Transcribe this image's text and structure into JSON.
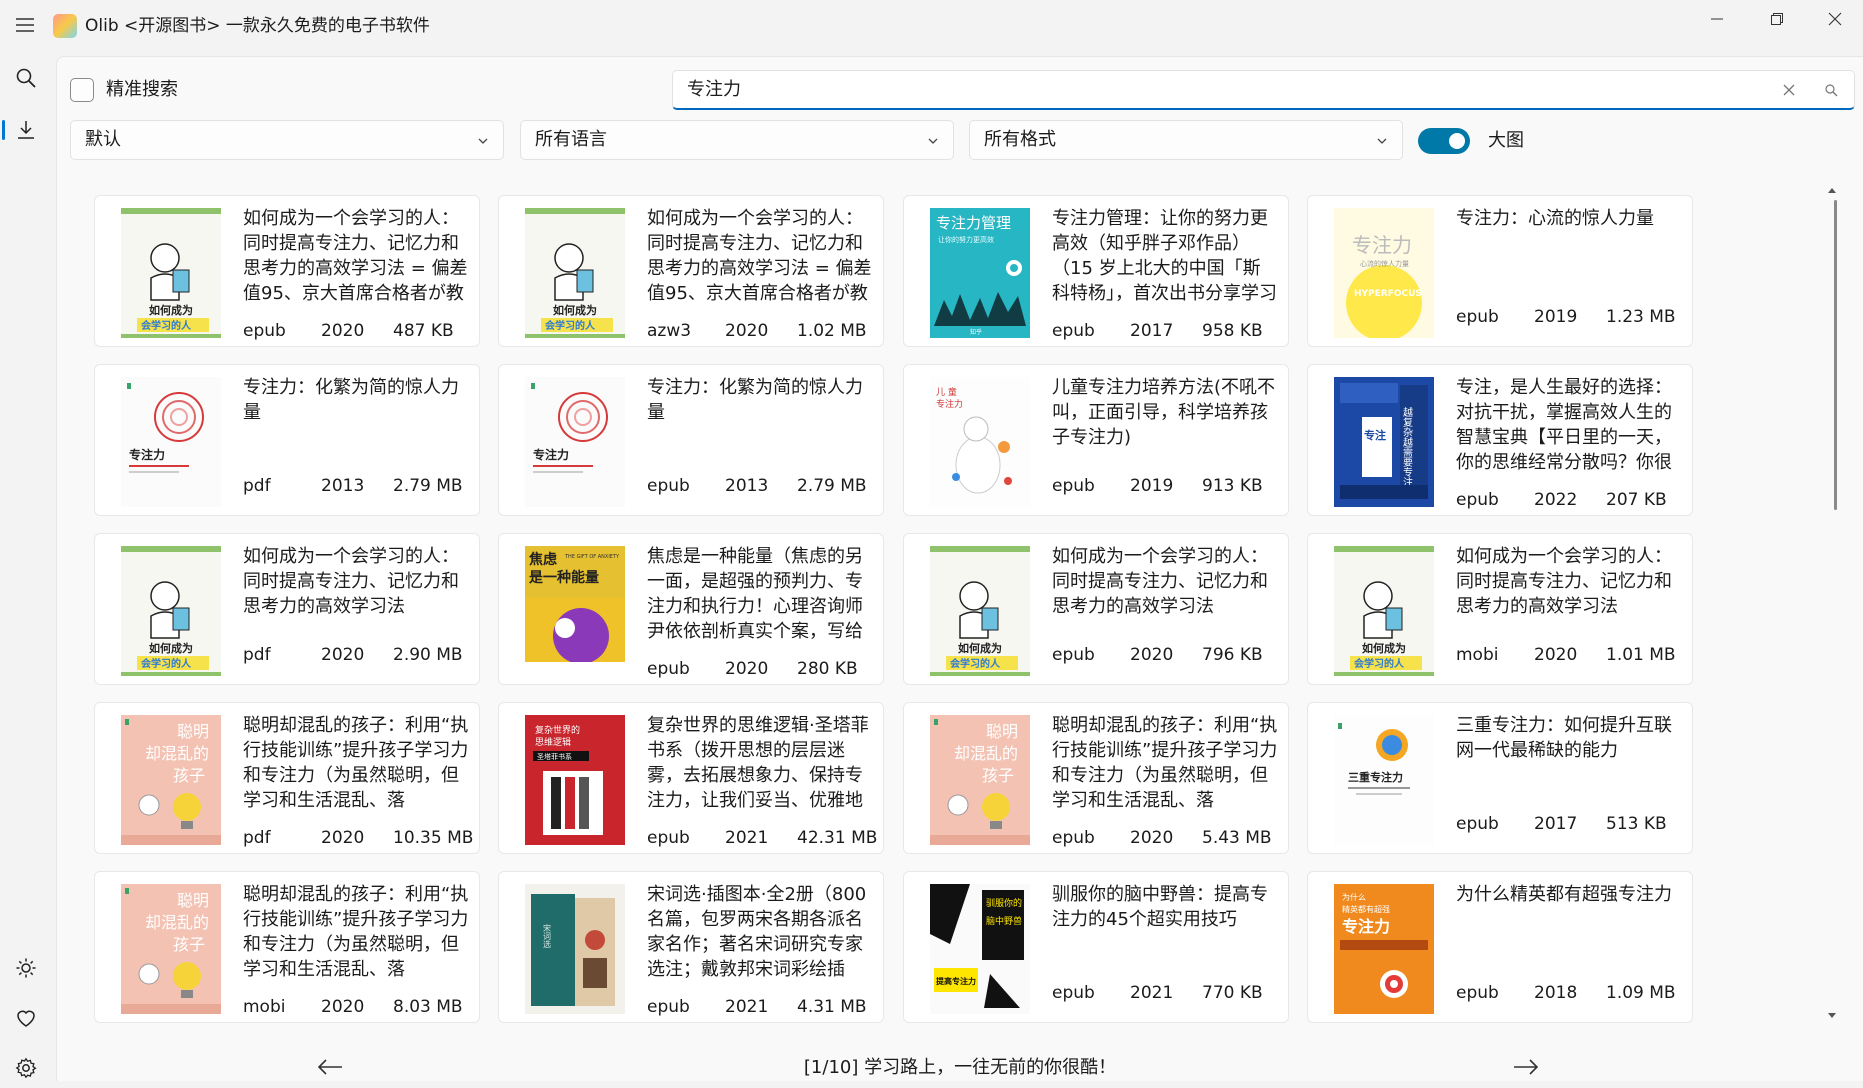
{
  "app": {
    "title": "Olib <开源图书> 一款永久免费的电子书软件"
  },
  "search": {
    "exact_label": "精准搜索",
    "exact_checked": false,
    "query": "专注力"
  },
  "filters": {
    "sort": "默认",
    "language": "所有语言",
    "format": "所有格式",
    "large_cover_label": "大图",
    "large_cover_on": true
  },
  "books": [
    {
      "title": "如何成为一个会学习的人：同时提高专注力、记忆力和思考力的高效学习法 = 偏差值95、京大首席合格者が教",
      "format": "epub",
      "year": "2020",
      "size": "487 KB"
    },
    {
      "title": "如何成为一个会学习的人：同时提高专注力、记忆力和思考力的高效学习法 = 偏差值95、京大首席合格者が教",
      "format": "azw3",
      "year": "2020",
      "size": "1.02 MB"
    },
    {
      "title": "专注力管理：让你的努力更高效（知乎胖子邓作品）（15 岁上北大的中国「斯科特杨」，首次出书分享学习",
      "format": "epub",
      "year": "2017",
      "size": "958 KB"
    },
    {
      "title": "专注力：心流的惊人力量",
      "format": "epub",
      "year": "2019",
      "size": "1.23 MB"
    },
    {
      "title": "专注力：化繁为简的惊人力量",
      "format": "pdf",
      "year": "2013",
      "size": "2.79 MB"
    },
    {
      "title": "专注力：化繁为简的惊人力量",
      "format": "epub",
      "year": "2013",
      "size": "2.79 MB"
    },
    {
      "title": "儿童专注力培养方法(不吼不叫，正面引导，科学培养孩子专注力)",
      "format": "epub",
      "year": "2019",
      "size": "913 KB"
    },
    {
      "title": "专注，是人生最好的选择：对抗干扰，掌握高效人生的智慧宝典【平日里的一天，你的思维经常分散吗？你很",
      "format": "epub",
      "year": "2022",
      "size": "207 KB"
    },
    {
      "title": "如何成为一个会学习的人：同时提高专注力、记忆力和思考力的高效学习法",
      "format": "pdf",
      "year": "2020",
      "size": "2.90 MB"
    },
    {
      "title": "焦虑是一种能量（焦虑的另一面，是超强的预判力、专注力和执行力！心理咨询师尹依依剖析真实个案，写给",
      "format": "epub",
      "year": "2020",
      "size": "280 KB"
    },
    {
      "title": "如何成为一个会学习的人：同时提高专注力、记忆力和思考力的高效学习法",
      "format": "epub",
      "year": "2020",
      "size": "796 KB"
    },
    {
      "title": "如何成为一个会学习的人：同时提高专注力、记忆力和思考力的高效学习法",
      "format": "mobi",
      "year": "2020",
      "size": "1.01 MB"
    },
    {
      "title": "聪明却混乱的孩子：利用“执行技能训练”提升孩子学习力和专注力（为虽然聪明，但学习和生活混乱、落",
      "format": "pdf",
      "year": "2020",
      "size": "10.35 MB"
    },
    {
      "title": "复杂世界的思维逻辑·圣塔菲书系（拨开思想的层层迷雾，去拓展想象力、保持专注力，让我们妥当、优雅地",
      "format": "epub",
      "year": "2021",
      "size": "42.31 MB"
    },
    {
      "title": "聪明却混乱的孩子：利用“执行技能训练”提升孩子学习力和专注力（为虽然聪明，但学习和生活混乱、落",
      "format": "epub",
      "year": "2020",
      "size": "5.43 MB"
    },
    {
      "title": "三重专注力：如何提升互联网一代最稀缺的能力",
      "format": "epub",
      "year": "2017",
      "size": "513 KB"
    },
    {
      "title": "聪明却混乱的孩子：利用“执行技能训练”提升孩子学习力和专注力（为虽然聪明，但学习和生活混乱、落",
      "format": "mobi",
      "year": "2020",
      "size": "8.03 MB"
    },
    {
      "title": "宋词选·插图本·全2册（800名篇，包罗两宋各期各派名家名作；著名宋词研究专家选注；戴敦邦宋词彩绘插",
      "format": "epub",
      "year": "2021",
      "size": "4.31 MB"
    },
    {
      "title": "驯服你的脑中野兽：提高专注力的45个超实用技巧",
      "format": "epub",
      "year": "2021",
      "size": "770 KB"
    },
    {
      "title": "为什么精英都有超强专注力",
      "format": "epub",
      "year": "2018",
      "size": "1.09 MB"
    }
  ],
  "covers": [
    {
      "style": "learn",
      "text1": "如何成为",
      "text2": "会学习的人"
    },
    {
      "style": "learn",
      "text1": "如何成为",
      "text2": "会学习的人"
    },
    {
      "style": "teal",
      "text1": "专注力管理",
      "text2": "让你的努力更高效",
      "text3": "知乎"
    },
    {
      "style": "yellow",
      "text1": "专注力",
      "text2": "心流的惊人力量",
      "text3": "HYPERFOCUS"
    },
    {
      "style": "spiral",
      "text1": "专注力"
    },
    {
      "style": "spiral",
      "text1": "专注力"
    },
    {
      "style": "child",
      "text1": "儿童专注力培养方法"
    },
    {
      "style": "blue",
      "text1": "专注",
      "text2": "越复杂越需要专注"
    },
    {
      "style": "learn",
      "text1": "如何成为",
      "text2": "会学习的人"
    },
    {
      "style": "anxiety",
      "text1": "焦虑",
      "text2": "是一种能量",
      "text3": "THE GIFT OF ANXIETY"
    },
    {
      "style": "learn",
      "text1": "如何成为",
      "text2": "会学习的人"
    },
    {
      "style": "learn",
      "text1": "如何成为",
      "text2": "会学习的人"
    },
    {
      "style": "pink",
      "text1": "聪明",
      "text2": "却混乱的",
      "text3": "孩子"
    },
    {
      "style": "red",
      "text1": "复杂世界的",
      "text2": "思维逻辑",
      "text3": "圣塔菲书系"
    },
    {
      "style": "pink",
      "text1": "聪明",
      "text2": "却混乱的",
      "text3": "孩子"
    },
    {
      "style": "triple",
      "text1": "三重专注力"
    },
    {
      "style": "pink",
      "text1": "聪明",
      "text2": "却混乱的",
      "text3": "孩子"
    },
    {
      "style": "song",
      "text1": "宋词选"
    },
    {
      "style": "beast",
      "text1": "驯服你的",
      "text2": "脑中野兽",
      "text3": "提高专注力"
    },
    {
      "style": "orange",
      "text1": "为什么",
      "text2": "精英都有超强",
      "text3": "专注力"
    }
  ],
  "pager": {
    "text": "[1/10] 学习路上，一往无前的你很酷！"
  }
}
